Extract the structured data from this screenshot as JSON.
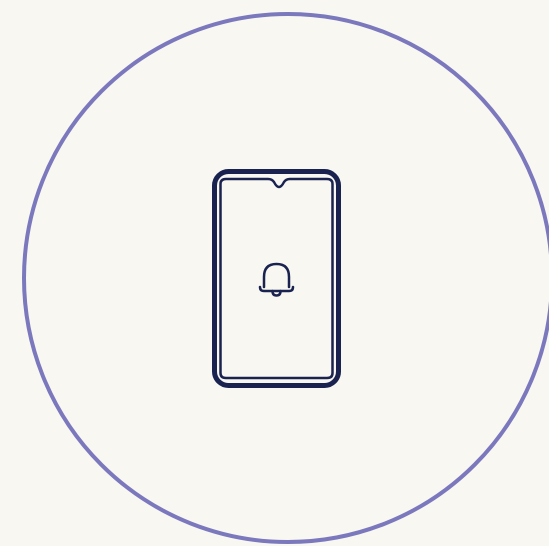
{
  "icons": {
    "frame": "circle-outline-icon",
    "device": "smartphone-icon",
    "notification": "bell-icon"
  },
  "colors": {
    "background": "#f8f7f1",
    "circle_stroke": "#7b78bd",
    "phone_stroke": "#1a2250"
  }
}
